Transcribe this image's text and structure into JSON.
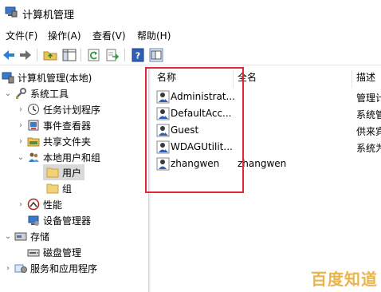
{
  "window": {
    "title": "计算机管理"
  },
  "menu": [
    "文件(F)",
    "操作(A)",
    "查看(V)",
    "帮助(H)"
  ],
  "toolbar": {
    "buttons": [
      "back-arrow-icon",
      "forward-arrow-icon",
      "folder-up-icon",
      "console-tree-icon",
      "refresh-icon",
      "export-list-icon",
      "help-icon",
      "properties-icon"
    ]
  },
  "tree": {
    "root": "计算机管理(本地)",
    "system_tools": "系统工具",
    "task_scheduler": "任务计划程序",
    "event_viewer": "事件查看器",
    "shared_folders": "共享文件夹",
    "local_users_groups": "本地用户和组",
    "users": "用户",
    "groups": "组",
    "performance": "性能",
    "device_manager": "设备管理器",
    "storage": "存储",
    "disk_management": "磁盘管理",
    "services_apps": "服务和应用程序"
  },
  "list": {
    "columns": {
      "name": "名称",
      "fullname": "全名",
      "desc": "描述"
    },
    "rows": [
      {
        "name": "Administrat...",
        "fullname": "",
        "desc": "管理计"
      },
      {
        "name": "DefaultAcc...",
        "fullname": "",
        "desc": "系统管"
      },
      {
        "name": "Guest",
        "fullname": "",
        "desc": "供来宾"
      },
      {
        "name": "WDAGUtilit...",
        "fullname": "",
        "desc": "系统为"
      },
      {
        "name": "zhangwen",
        "fullname": "zhangwen",
        "desc": ""
      }
    ]
  },
  "watermark": "百度知道",
  "colors": {
    "highlight": "#e3263a",
    "selected": "#d9d9d9",
    "watermark": "#e8b44c"
  }
}
